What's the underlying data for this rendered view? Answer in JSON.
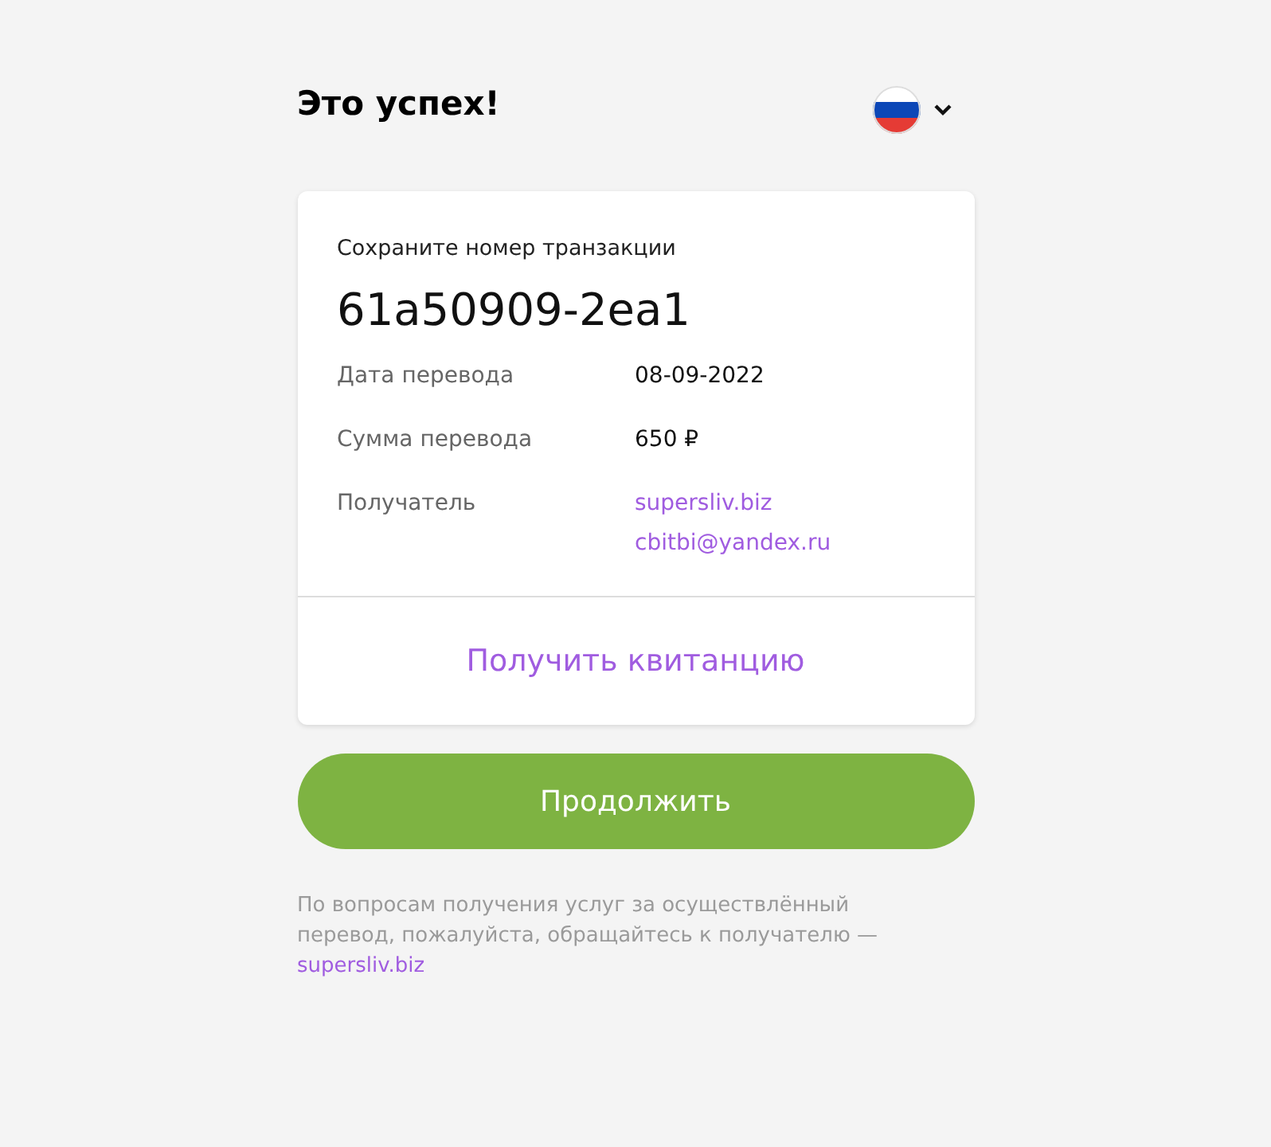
{
  "header": {
    "title": "Это успех!"
  },
  "card": {
    "caption": "Сохраните номер транзакции",
    "transaction_id": "61a50909-2ea1",
    "details": [
      {
        "label": "Дата перевода",
        "kind": "plain",
        "values": [
          "08-09-2022"
        ]
      },
      {
        "label": "Сумма перевода",
        "kind": "plain",
        "values": [
          "650 ₽"
        ]
      },
      {
        "label": "Получатель",
        "kind": "link",
        "values": [
          "supersliv.biz",
          "cbitbi@yandex.ru"
        ]
      }
    ],
    "receipt_link": "Получить квитанцию"
  },
  "continue_button": "Продолжить",
  "footer": {
    "text": "По вопросам получения услуг за осуществлённый перевод, пожалуйста, обращайтесь к получателю —",
    "link": "supersliv.biz"
  }
}
